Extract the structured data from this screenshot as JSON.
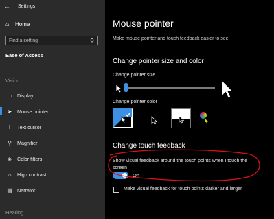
{
  "window": {
    "title": "Settings"
  },
  "sidebar": {
    "home_label": "Home",
    "search_placeholder": "Find a setting",
    "section_title": "Ease of Access",
    "groups": {
      "vision": "Vision",
      "hearing": "Hearing"
    },
    "items": [
      {
        "label": "Display",
        "icon": "display-icon"
      },
      {
        "label": "Mouse pointer",
        "icon": "mouse-pointer-icon",
        "active": true
      },
      {
        "label": "Text cursor",
        "icon": "text-cursor-icon"
      },
      {
        "label": "Magnifier",
        "icon": "magnifier-icon"
      },
      {
        "label": "Color filters",
        "icon": "color-filters-icon"
      },
      {
        "label": "High contrast",
        "icon": "high-contrast-icon"
      },
      {
        "label": "Narrator",
        "icon": "narrator-icon"
      }
    ]
  },
  "main": {
    "title": "Mouse pointer",
    "description": "Make mouse pointer and touch feedback easier to see.",
    "size_color_heading": "Change pointer size and color",
    "pointer_size_label": "Change pointer size",
    "pointer_size_value": 0.0,
    "pointer_color_label": "Change pointer color",
    "pointer_color_selected": "white",
    "touch_heading": "Change touch feedback",
    "touch_toggle_text": "Show visual feedback around the touch points when I touch the screen",
    "touch_toggle_state": "On",
    "touch_toggle_on": true,
    "darker_checkbox_label": "Make visual feedback for touch points darker and larger",
    "darker_checkbox_checked": false
  },
  "colors": {
    "accent": "#3d8fe2",
    "sidebar_bg": "#2b2b2b",
    "annotation": "#e0101a"
  }
}
